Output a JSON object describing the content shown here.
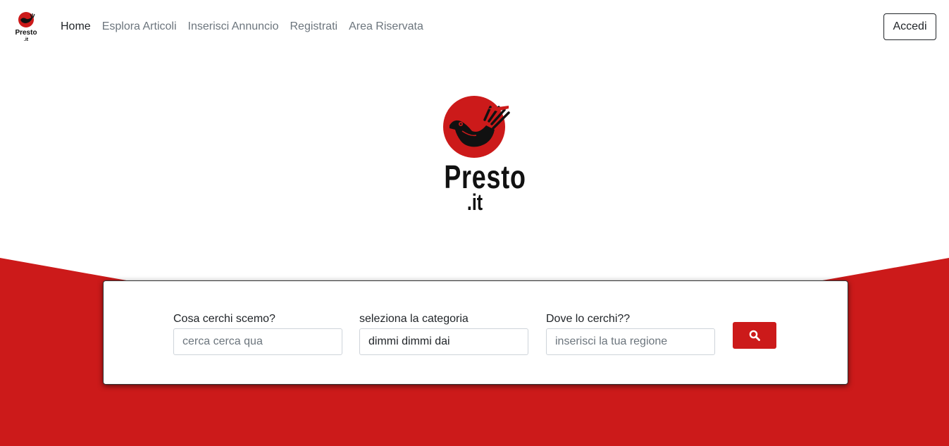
{
  "brand": {
    "name": "Presto",
    "domain": ".it"
  },
  "nav": {
    "links": [
      {
        "label": "Home",
        "active": true
      },
      {
        "label": "Esplora Articoli",
        "active": false
      },
      {
        "label": "Inserisci Annuncio",
        "active": false
      },
      {
        "label": "Registrati",
        "active": false
      },
      {
        "label": "Area Riservata",
        "active": false
      }
    ],
    "login_label": "Accedi"
  },
  "search": {
    "query": {
      "label": "Cosa cerchi scemo?",
      "placeholder": "cerca cerca qua",
      "value": ""
    },
    "category": {
      "label": "seleziona la categoria",
      "selected": "dimmi dimmi dai"
    },
    "region": {
      "label": "Dove lo cerchi??",
      "placeholder": "inserisci la tua regione",
      "value": ""
    },
    "button_icon": "search-icon"
  },
  "colors": {
    "brand_red": "#cc1a1a",
    "text_dark": "#212529",
    "text_muted": "#6c757d"
  }
}
